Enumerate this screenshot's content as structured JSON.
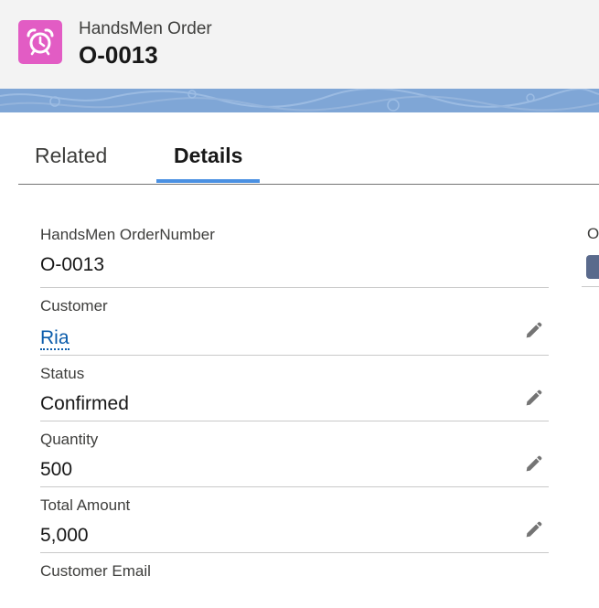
{
  "header": {
    "object_label": "HandsMen Order",
    "record_name": "O-0013",
    "icon": "alarm-clock-icon",
    "icon_color": "#e25cc4"
  },
  "tabs": [
    {
      "label": "Related",
      "active": false
    },
    {
      "label": "Details",
      "active": true
    }
  ],
  "details": {
    "fields": [
      {
        "label": "HandsMen OrderNumber",
        "value": "O-0013",
        "editable": false
      },
      {
        "label": "Customer",
        "value": "Ria",
        "link": true,
        "editable": true
      },
      {
        "label": "Status",
        "value": "Confirmed",
        "editable": true
      },
      {
        "label": "Quantity",
        "value": "500",
        "editable": true
      },
      {
        "label": "Total Amount",
        "value": "5,000",
        "editable": true
      },
      {
        "label": "Customer Email",
        "value": "",
        "editable": true
      }
    ],
    "right_column_label_partial": "O"
  },
  "colors": {
    "tab_accent": "#4a90e2",
    "link": "#0b5cab",
    "banner": "#7fa6d6"
  }
}
